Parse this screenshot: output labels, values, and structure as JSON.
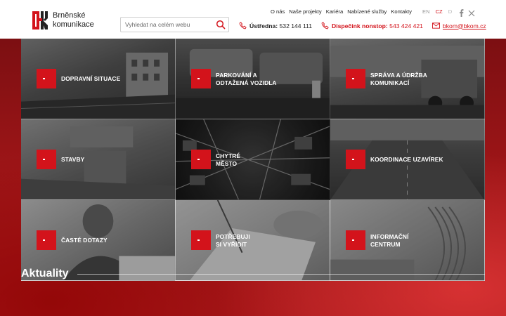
{
  "brand": {
    "name_line1": "Brněnské",
    "name_line2": "komunikace",
    "accent": "#d3131b"
  },
  "search": {
    "placeholder": "Vyhledat na celém webu",
    "icon": "search-icon"
  },
  "topnav": [
    "O nás",
    "Naše projekty",
    "Kariéra",
    "Nabízené služby",
    "Kontakty"
  ],
  "languages": {
    "en": "EN",
    "cz": "CZ",
    "d": "D",
    "active": "CZ"
  },
  "social": [
    "facebook-icon",
    "x-twitter-icon"
  ],
  "contacts": {
    "ustredna_label": "Ústředna:",
    "ustredna_number": "532 144 111",
    "dispecink_label": "Dispečink nonstop:",
    "dispecink_number": "543 424 421",
    "email": "bkom@bkom.cz"
  },
  "tiles": [
    {
      "line1": "DOPRAVNÍ SITUACE",
      "line2": ""
    },
    {
      "line1": "PARKOVÁNÍ A",
      "line2": "ODTAŽENÁ VOZIDLA"
    },
    {
      "line1": "SPRÁVA A ÚDRŽBA",
      "line2": "KOMUNIKACÍ"
    },
    {
      "line1": "STAVBY",
      "line2": ""
    },
    {
      "line1": "CHYTRÉ",
      "line2": "MĚSTO"
    },
    {
      "line1": "KOORDINACE UZAVÍREK",
      "line2": ""
    },
    {
      "line1": "ČASTÉ DOTAZY",
      "line2": ""
    },
    {
      "line1": "POTŘEBUJI",
      "line2": "SI VYŘÍDIT"
    },
    {
      "line1": "INFORMAČNÍ",
      "line2": "CENTRUM"
    }
  ],
  "news": {
    "heading": "Aktuality"
  }
}
